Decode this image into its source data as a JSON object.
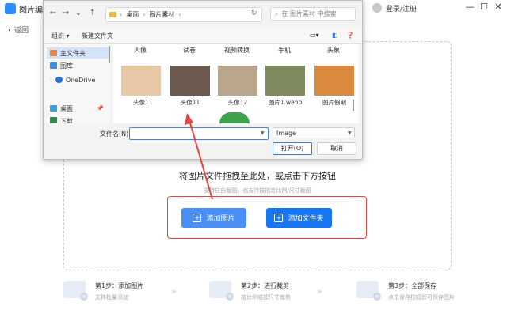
{
  "app": {
    "title": "图片编辑",
    "login": "登录/注册",
    "back": "返回",
    "window_controls": [
      "minimize-icon",
      "restore-icon",
      "close-icon"
    ]
  },
  "dropzone": {
    "title": "将图片文件拖拽至此处，或点击下方按钮",
    "subtitle": "支持自由截图，也支持按指定比例/尺寸截图",
    "add_image": "添加图片",
    "add_folder": "添加文件夹"
  },
  "steps": [
    {
      "title": "第1步：添加图片",
      "desc": "支持批量添加"
    },
    {
      "title": "第2步：进行裁剪",
      "desc": "按比例或按尺寸裁剪"
    },
    {
      "title": "第3步：全部保存",
      "desc": "点击保存按钮即可保存图片"
    }
  ],
  "dialog": {
    "breadcrumb": [
      "桌面",
      "图片素材"
    ],
    "search_placeholder": "在 图片素材 中搜索",
    "toolbar": {
      "organize": "组织",
      "new_folder": "新建文件夹"
    },
    "nav": [
      {
        "label": "主文件夹",
        "selected": true,
        "icon": "home-icon"
      },
      {
        "label": "图库",
        "selected": false,
        "icon": "gallery-icon"
      },
      {
        "label": "OneDrive",
        "selected": false,
        "icon": "cloud-icon"
      },
      {
        "label": "桌面",
        "selected": false,
        "icon": "desktop-icon"
      },
      {
        "label": "下载",
        "selected": false,
        "icon": "download-icon"
      }
    ],
    "top_labels": [
      "人像",
      "试卷",
      "视频转换",
      "手机",
      "头象"
    ],
    "files": [
      {
        "name": "头像1",
        "color": "#e7c7a5"
      },
      {
        "name": "头像11",
        "color": "#6b5a4d"
      },
      {
        "name": "头像12",
        "color": "#b9a68c"
      },
      {
        "name": "图片1.webp",
        "color": "#7f8a5e"
      },
      {
        "name": "图片假期",
        "color": "#d98a3c"
      }
    ],
    "filename_label": "文件名(N):",
    "filename_value": "",
    "file_type": "Image",
    "open_button": "打开(O)",
    "cancel_button": "取消"
  },
  "colors": {
    "accent": "#1777f2",
    "highlight_border": "#e8453c"
  }
}
